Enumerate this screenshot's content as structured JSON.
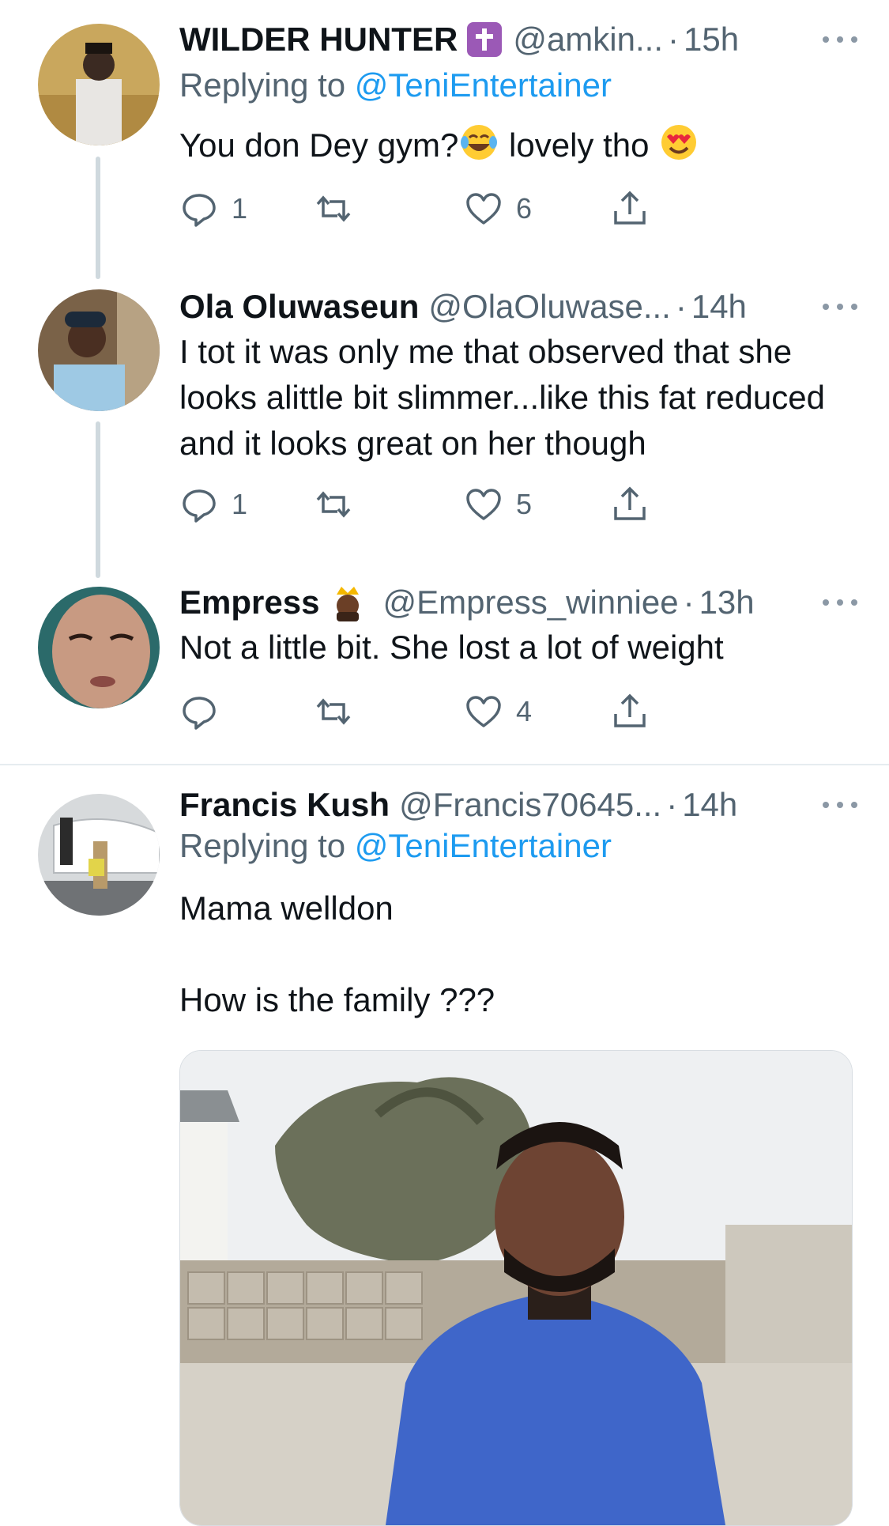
{
  "tweets": [
    {
      "name": "WILDER HUNTER",
      "handle": "@amkin...",
      "time": "15h",
      "replying_label": "Replying to",
      "replying_to": "@TeniEntertainer",
      "text_a": "You don Dey gym?",
      "text_b": " lovely tho ",
      "replies": "1",
      "likes": "6"
    },
    {
      "name": "Ola Oluwaseun",
      "handle": "@OlaOluwase...",
      "time": "14h",
      "text": "I tot it was only me that observed that she looks alittle bit slimmer...like this fat reduced and it looks great on her though",
      "replies": "1",
      "likes": "5"
    },
    {
      "name": "Empress",
      "handle": "@Empress_winniee",
      "time": "13h",
      "text": "Not a little bit. She lost a lot of weight",
      "likes": "4"
    },
    {
      "name": "Francis Kush",
      "handle": "@Francis70645...",
      "time": "14h",
      "replying_label": "Replying to",
      "replying_to": "@TeniEntertainer",
      "text_line1": "Mama welldon",
      "text_line2": "How is the family ???"
    }
  ],
  "separator": "·",
  "icons": {
    "reply": "reply-icon",
    "retweet": "retweet-icon",
    "like": "heart-icon",
    "share": "share-icon",
    "more": "more-icon"
  },
  "colors": {
    "link": "#1d9bf0",
    "secondary": "#536471",
    "primary_text": "#0f1419"
  }
}
